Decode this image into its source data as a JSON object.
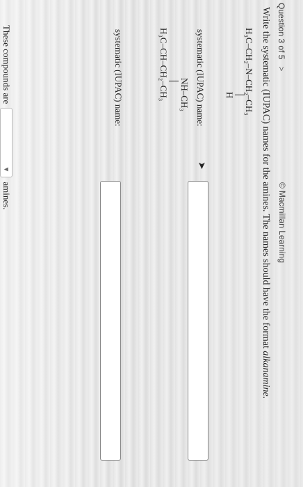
{
  "header": {
    "question_label": "Question 3 of 5",
    "nav_arrow": ">",
    "brand_symbol": "©",
    "brand_text": "Macmillan Learning"
  },
  "instructions": {
    "main": "Write the systematic (IUPAC) names for the amines. The names should have the format ",
    "format": "alkanamine."
  },
  "molecule1": {
    "line": "H₃C–CH₂–N–CH₂–CH₃",
    "h": "H"
  },
  "molecule2": {
    "top": "NH–CH₃",
    "bottom": "H₃C–CH–CH₂–CH₃"
  },
  "answers": {
    "label1": "systematic (IUPAC) name:",
    "label2": "systematic (IUPAC) name:",
    "value1": "",
    "value2": ""
  },
  "footer": {
    "prefix": "These compounds are",
    "select_value": "",
    "select_caret": "▼",
    "suffix": "amines."
  }
}
